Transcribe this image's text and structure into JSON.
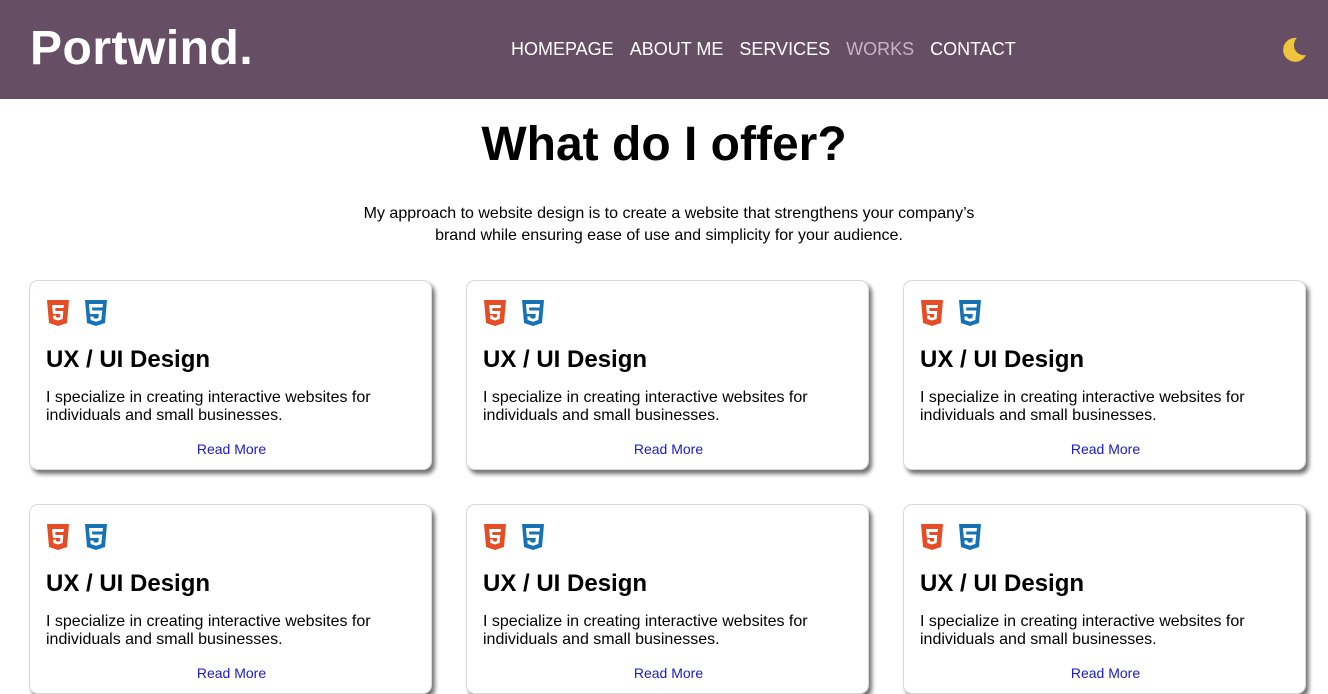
{
  "header": {
    "logo": "Portwind.",
    "nav": [
      "HOMEPAGE",
      "ABOUT ME",
      "SERVICES",
      "WORKS",
      "CONTACT"
    ],
    "active_nav": "WORKS",
    "theme_icon": "moon-icon",
    "theme_icon_color": "#f0c53c",
    "background": "#664e65"
  },
  "section": {
    "title": "What do I offer?",
    "intro": "My approach to website design is to create a website that strengthens your company’s brand while ensuring ease of use and simplicity for your audience."
  },
  "cards": [
    {
      "icons": [
        "html5-icon",
        "css3-icon"
      ],
      "title": "UX / UI Design",
      "text": "I specialize in creating interactive websites for individuals and small businesses.",
      "link": "Read More"
    },
    {
      "icons": [
        "html5-icon",
        "css3-icon"
      ],
      "title": "UX / UI Design",
      "text": "I specialize in creating interactive websites for individuals and small businesses.",
      "link": "Read More"
    },
    {
      "icons": [
        "html5-icon",
        "css3-icon"
      ],
      "title": "UX / UI Design",
      "text": "I specialize in creating interactive websites for individuals and small businesses.",
      "link": "Read More"
    },
    {
      "icons": [
        "html5-icon",
        "css3-icon"
      ],
      "title": "UX / UI Design",
      "text": "I specialize in creating interactive websites for individuals and small businesses.",
      "link": "Read More"
    },
    {
      "icons": [
        "html5-icon",
        "css3-icon"
      ],
      "title": "UX / UI Design",
      "text": "I specialize in creating interactive websites for individuals and small businesses.",
      "link": "Read More"
    },
    {
      "icons": [
        "html5-icon",
        "css3-icon"
      ],
      "title": "UX / UI Design",
      "text": "I specialize in creating interactive websites for individuals and small businesses.",
      "link": "Read More"
    }
  ],
  "colors": {
    "html5": "#e44d26",
    "css3": "#1572b6",
    "link": "#1a1acc"
  }
}
